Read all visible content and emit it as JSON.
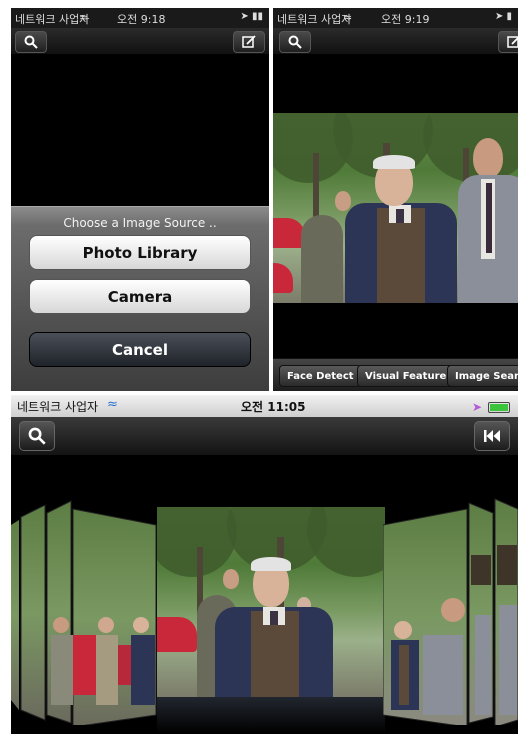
{
  "panel1": {
    "status": {
      "carrier": "네트워크 사업자",
      "time": "오전 9:18"
    },
    "sheet": {
      "title": "Choose a Image Source ..",
      "buttons": {
        "photo_library": "Photo Library",
        "camera": "Camera",
        "cancel": "Cancel"
      }
    },
    "icons": {
      "left": "search-icon",
      "right": "compose-icon"
    }
  },
  "panel2": {
    "status": {
      "carrier": "네트워크 사업자",
      "time": "오전 9:19"
    },
    "toolbar": {
      "face_detect": "Face Detect",
      "visual_feature": "Visual Feature",
      "image_search": "Image Search"
    },
    "icons": {
      "left": "search-icon",
      "right": "compose-icon"
    }
  },
  "panel3": {
    "status": {
      "carrier": "네트워크 사업자",
      "time": "오전 11:05"
    },
    "icons": {
      "left": "search-icon",
      "right": "rewind-icon"
    },
    "colors": {
      "location_arrow": "#b45ad6",
      "battery": "#3cc43c",
      "wifi": "#2a6fd1"
    }
  }
}
